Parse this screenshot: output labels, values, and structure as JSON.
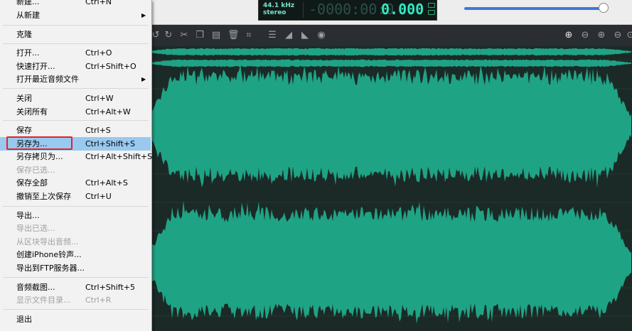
{
  "display": {
    "sample_rate": "44.1 kHz",
    "channels": "stereo",
    "time_dim": "-0000:00:0",
    "time": "0.000"
  },
  "menu": {
    "items": [
      {
        "label": "新建...",
        "shortcut": "Ctrl+N"
      },
      {
        "label": "从新建",
        "shortcut": "",
        "submenu": true
      },
      {
        "label": "克隆",
        "shortcut": ""
      },
      {
        "label": "打开...",
        "shortcut": "Ctrl+O"
      },
      {
        "label": "快速打开...",
        "shortcut": "Ctrl+Shift+O"
      },
      {
        "label": "打开最近音频文件",
        "shortcut": "",
        "submenu": true
      },
      {
        "label": "关闭",
        "shortcut": "Ctrl+W"
      },
      {
        "label": "关闭所有",
        "shortcut": "Ctrl+Alt+W"
      },
      {
        "label": "保存",
        "shortcut": "Ctrl+S"
      },
      {
        "label": "另存为...",
        "shortcut": "Ctrl+Shift+S",
        "highlighted": true
      },
      {
        "label": "另存拷贝为...",
        "shortcut": "Ctrl+Alt+Shift+S"
      },
      {
        "label": "保存已选...",
        "shortcut": "",
        "disabled": true
      },
      {
        "label": "保存全部",
        "shortcut": "Ctrl+Alt+S"
      },
      {
        "label": "撤销至上次保存",
        "shortcut": "Ctrl+U"
      },
      {
        "label": "导出...",
        "shortcut": ""
      },
      {
        "label": "导出已选...",
        "shortcut": "",
        "disabled": true
      },
      {
        "label": "从区块导出音频...",
        "shortcut": "",
        "disabled": true
      },
      {
        "label": "创建iPhone铃声...",
        "shortcut": ""
      },
      {
        "label": "导出到FTP服务器...",
        "shortcut": ""
      },
      {
        "label": "音频截图...",
        "shortcut": "Ctrl+Shift+5"
      },
      {
        "label": "显示文件目录...",
        "shortcut": "Ctrl+R",
        "disabled": true
      },
      {
        "label": "退出",
        "shortcut": ""
      }
    ]
  },
  "toolbar": {
    "icons": [
      "undo-icon",
      "redo-icon",
      "cut-icon",
      "copy-icon",
      "paste-icon",
      "delete-icon",
      "crop-icon",
      "normalize-icon",
      "fade-in-icon",
      "fade-out-icon",
      "effect-icon",
      "zoom-in-all-icon",
      "zoom-out-all-icon",
      "zoom-in-icon",
      "zoom-out-icon",
      "zoom-fit-icon"
    ]
  },
  "colors": {
    "waveform": "#1fa385",
    "waveform_bg": "#1b2a26",
    "highlight": "#99c9ef",
    "annotation_box": "#e0252b"
  }
}
